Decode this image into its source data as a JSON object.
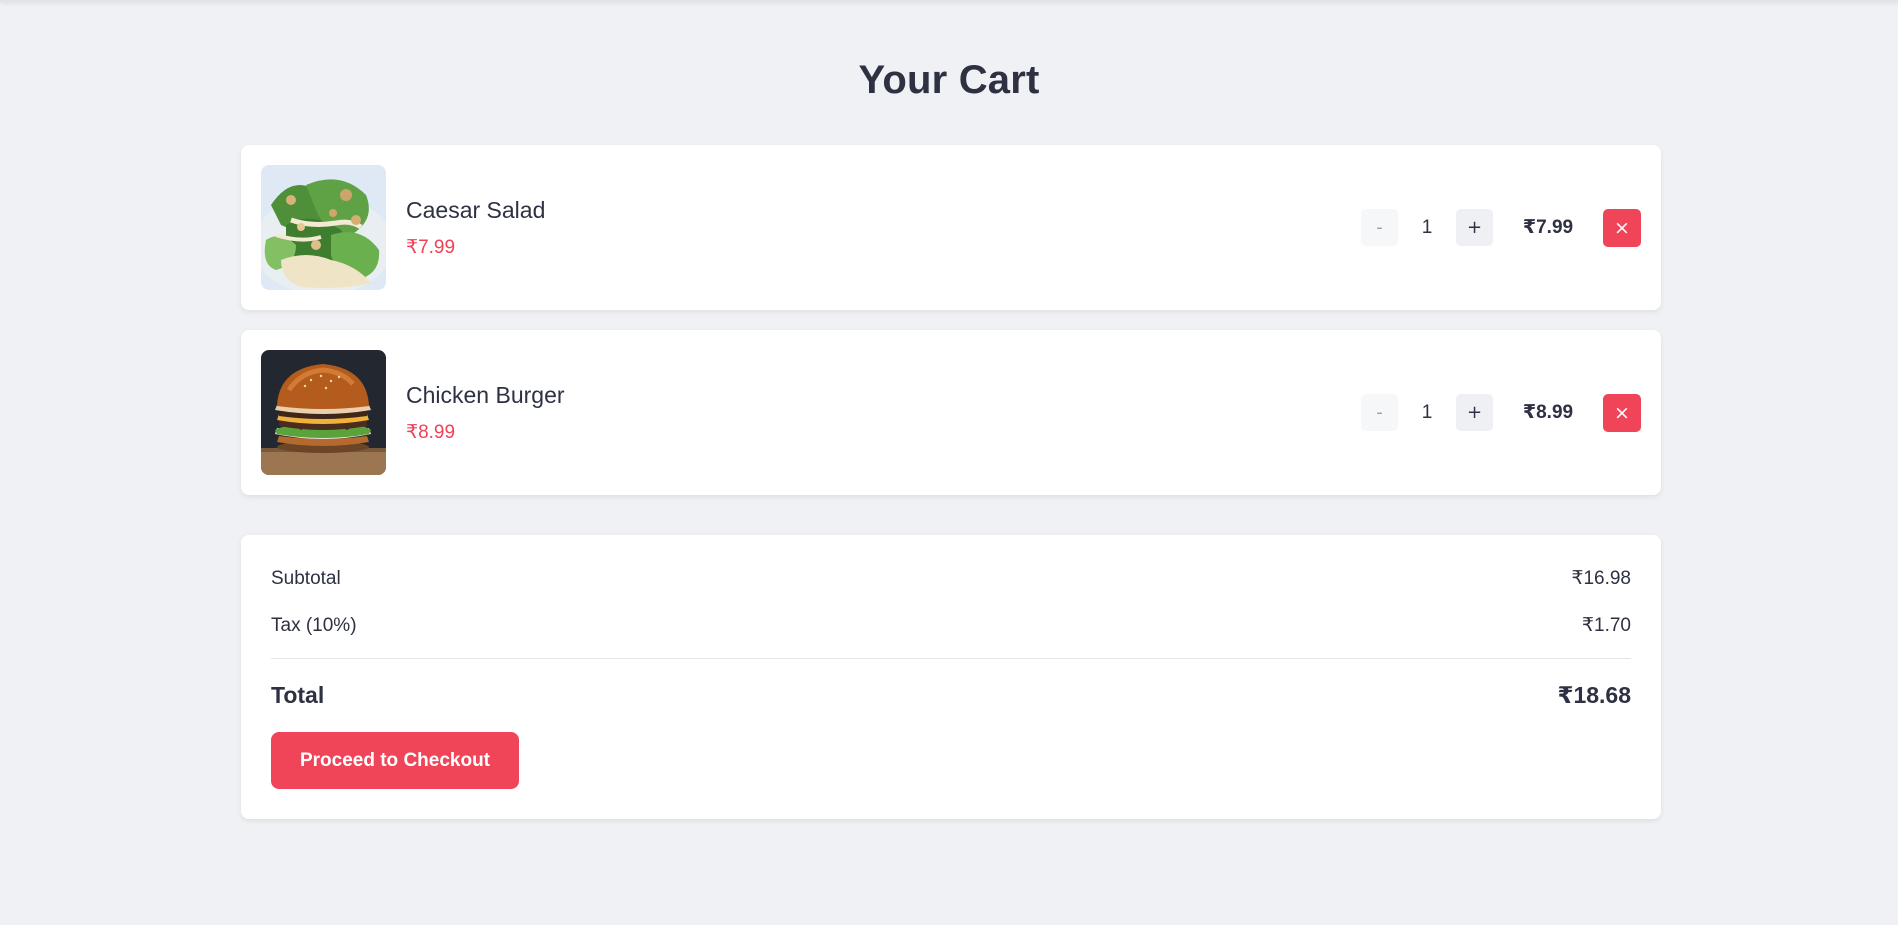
{
  "page": {
    "title": "Your Cart"
  },
  "cart": {
    "items": [
      {
        "name": "Caesar Salad",
        "price": "₹7.99",
        "quantity": "1",
        "line_total": "₹7.99",
        "decrement_label": "-",
        "increment_label": "+",
        "remove_label": "×",
        "image_icon": "caesar-salad-photo"
      },
      {
        "name": "Chicken Burger",
        "price": "₹8.99",
        "quantity": "1",
        "line_total": "₹8.99",
        "decrement_label": "-",
        "increment_label": "+",
        "remove_label": "×",
        "image_icon": "chicken-burger-photo"
      }
    ]
  },
  "summary": {
    "subtotal_label": "Subtotal",
    "subtotal_value": "₹16.98",
    "tax_label": "Tax (10%)",
    "tax_value": "₹1.70",
    "total_label": "Total",
    "total_value": "₹18.68",
    "checkout_label": "Proceed to Checkout"
  },
  "colors": {
    "accent": "#f04559",
    "background": "#f0f1f5",
    "text": "#2d3142"
  }
}
